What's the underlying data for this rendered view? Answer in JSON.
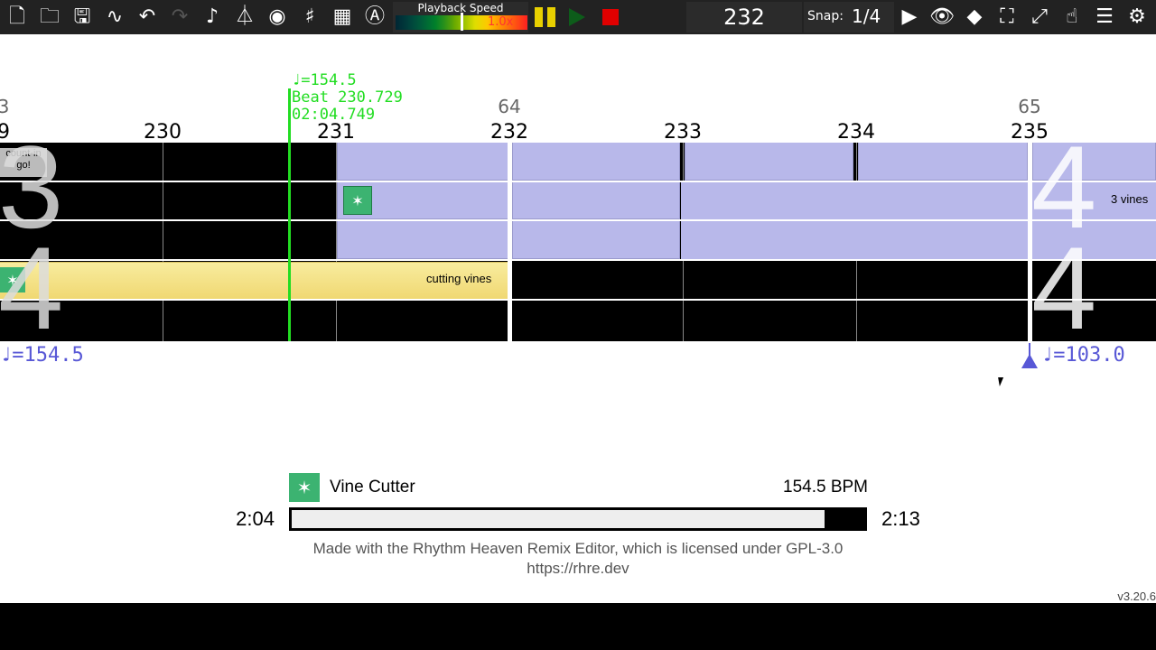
{
  "toolbar": {
    "playback_speed_label": "Playback Speed",
    "playback_speed_value": "1.0x",
    "current_beat": "232",
    "snap_label": "Snap:",
    "snap_value": "1/4",
    "icons": [
      "new-file-icon",
      "open-folder-icon",
      "save-icon",
      "music-waveform-icon",
      "undo-icon",
      "redo-icon",
      "music-note-icon",
      "metronome-icon",
      "audio-sync-icon",
      "time-signature-icon",
      "grid-icon",
      "autosave-icon",
      "pause-icon",
      "play-icon",
      "stop-icon",
      "presentation-icon",
      "view-icon",
      "palette-icon",
      "fullscreen-icon",
      "resize-icon",
      "tapalong-icon",
      "info-icon",
      "settings-icon"
    ]
  },
  "timeline": {
    "playhead": {
      "bpm": "♩=154.5",
      "beat": "Beat 230.729",
      "time": "02:04.749"
    },
    "ticks": [
      "9",
      "230",
      "231",
      "232",
      "233",
      "234",
      "235"
    ],
    "measures": [
      "3",
      "64",
      "65"
    ],
    "cue_labels": {
      "count_in": "count-in go!",
      "cutting_vines": "cutting vines",
      "three_vines": "3 vines"
    },
    "time_signatures": {
      "left_top": "3",
      "left_bottom": "4",
      "right_top": "4",
      "right_bottom": "4"
    },
    "tempo_changes": {
      "left": "♩=154.5",
      "right": "♩=103.0"
    }
  },
  "status": {
    "game_name": "Vine Cutter",
    "bpm": "154.5 BPM",
    "time_current": "2:04",
    "time_total": "2:13",
    "progress": 0.93,
    "license_text": "Made with the Rhythm Heaven Remix Editor, which is licensed under GPL-3.0",
    "url": "https://rhre.dev",
    "version": "v3.20.6"
  },
  "colors": {
    "playhead": "#22dd22",
    "cue_fill": "#b8b8ea",
    "yellow_cue": "#f5e28c",
    "tempo_text": "#5858d6",
    "stop": "#e00000",
    "pause": "#e8d000"
  }
}
